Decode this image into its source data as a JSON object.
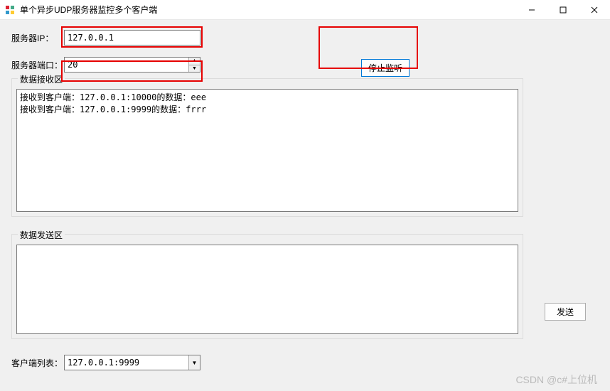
{
  "window": {
    "title": "单个异步UDP服务器监控多个客户端"
  },
  "labels": {
    "server_ip": "服务器IP：",
    "server_port": "服务器端口：",
    "recv_group": "数据接收区",
    "send_group": "数据发送区",
    "client_list": "客户端列表："
  },
  "fields": {
    "server_ip": "127.0.0.1",
    "server_port": "20",
    "send_text": "",
    "client_selected": "127.0.0.1:9999"
  },
  "buttons": {
    "stop_listen": "停止监听",
    "send": "发送"
  },
  "recv_lines": [
    "接收到客户端：127.0.0.1:10000的数据：eee",
    "接收到客户端：127.0.0.1:9999的数据：frrr"
  ],
  "watermark": "CSDN @c#上位机"
}
